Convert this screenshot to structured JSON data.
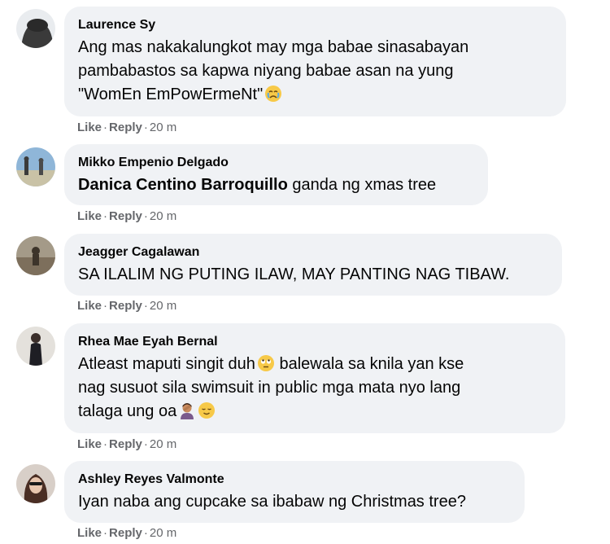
{
  "actions": {
    "like": "Like",
    "separator": "·",
    "reply": "Reply"
  },
  "comments": [
    {
      "author": "Laurence Sy",
      "text": "Ang mas nakakalungkot may mga babae sinasabayan\npambabastos sa kapwa niyang babae asan na yung\n\"WomEn EmPowErmeNt\"",
      "emoji": [
        "crying-face-icon"
      ],
      "time": "20 m"
    },
    {
      "author": "Mikko Empenio Delgado",
      "tag": "Danica Centino Barroquillo",
      "text": " ganda ng xmas tree",
      "time": "20 m"
    },
    {
      "author": "Jeagger Cagalawan",
      "text": "SA ILALIM NG PUTING ILAW, MAY PANTING NAG TIBAW.",
      "time": "20 m"
    },
    {
      "author": "Rhea Mae Eyah Bernal",
      "text_line1": "Atleast maputi singit duh",
      "text_line1b": " balewala sa knila yan kse",
      "text_line2": "nag susuot sila swimsuit in public mga mata nyo lang",
      "text_line3": "talaga ung oa",
      "emoji": [
        "rolling-eyes-icon",
        "person-facepalming-icon",
        "relieved-face-icon"
      ],
      "time": "20 m"
    },
    {
      "author": "Ashley Reyes Valmonte",
      "text": "Iyan naba ang cupcake sa ibabaw ng Christmas tree?",
      "time": "20 m"
    }
  ],
  "colors": {
    "bubble": "#f0f2f5",
    "meta": "#65676b",
    "text": "#050505"
  }
}
